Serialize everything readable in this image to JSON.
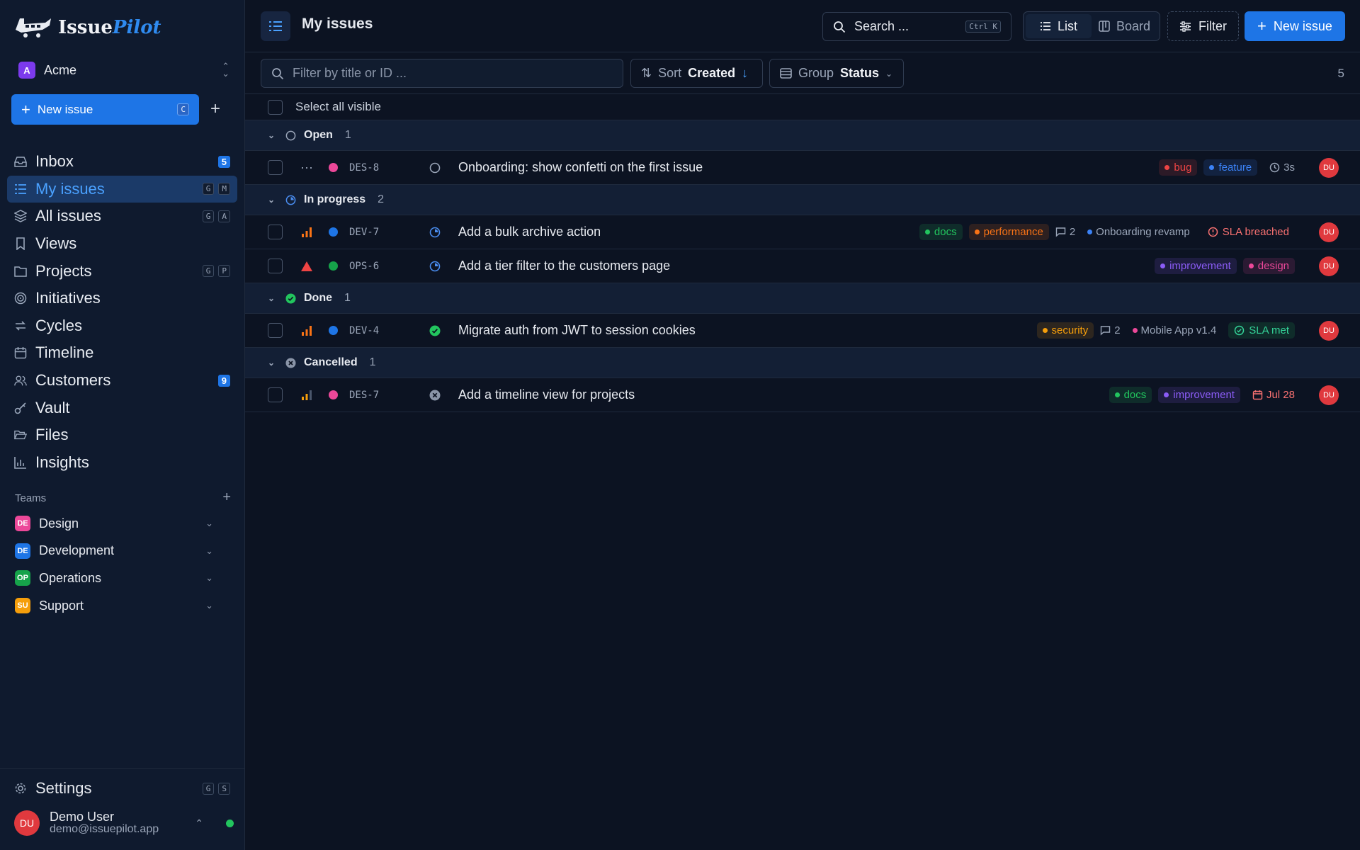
{
  "app": {
    "name_part1": "Issue",
    "name_part2": "Pilot"
  },
  "workspace": {
    "initial": "A",
    "name": "Acme"
  },
  "sidebar_new": {
    "label": "New issue",
    "shortcut": "C"
  },
  "nav": [
    {
      "label": "Inbox",
      "icon": "inbox-icon",
      "badge": "5"
    },
    {
      "label": "My issues",
      "icon": "my-issues-icon",
      "keys": [
        "G",
        "M"
      ],
      "active": true
    },
    {
      "label": "All issues",
      "icon": "layers-icon",
      "keys": [
        "G",
        "A"
      ]
    },
    {
      "label": "Views",
      "icon": "bookmark-icon"
    },
    {
      "label": "Projects",
      "icon": "folder-icon",
      "keys": [
        "G",
        "P"
      ]
    },
    {
      "label": "Initiatives",
      "icon": "target-icon"
    },
    {
      "label": "Cycles",
      "icon": "cycle-icon"
    },
    {
      "label": "Timeline",
      "icon": "calendar-icon"
    },
    {
      "label": "Customers",
      "icon": "users-icon",
      "badge": "9"
    },
    {
      "label": "Vault",
      "icon": "key-icon"
    },
    {
      "label": "Files",
      "icon": "folder-open-icon"
    },
    {
      "label": "Insights",
      "icon": "chart-icon"
    }
  ],
  "teams_heading": "Teams",
  "teams": [
    {
      "initials": "DE",
      "name": "Design",
      "color": "#ec4899"
    },
    {
      "initials": "DE",
      "name": "Development",
      "color": "#1e75e6"
    },
    {
      "initials": "OP",
      "name": "Operations",
      "color": "#16a34a"
    },
    {
      "initials": "SU",
      "name": "Support",
      "color": "#f59e0b"
    }
  ],
  "settings": {
    "label": "Settings",
    "keys": [
      "G",
      "S"
    ]
  },
  "user": {
    "initials": "DU",
    "name": "Demo User",
    "email": "demo@issuepilot.app"
  },
  "header": {
    "title": "My issues"
  },
  "search": {
    "placeholder": "Search ...",
    "shortcut": "Ctrl K"
  },
  "view_switch": {
    "list": "List",
    "board": "Board",
    "selected": "List"
  },
  "filter_label": "Filter",
  "new_issue_label": "New issue",
  "toolbar": {
    "filter_placeholder": "Filter by title or ID ...",
    "sort_label": "Sort",
    "sort_value": "Created",
    "group_label": "Group",
    "group_value": "Status",
    "count": "5"
  },
  "select_all_label": "Select all visible",
  "groups": [
    {
      "name": "Open",
      "count": "1",
      "status": "open",
      "issues": [
        {
          "id": "DES-8",
          "title": "Onboarding: show confetti on the first issue",
          "priority": "none",
          "team_color": "#ec4899",
          "labels": [
            {
              "text": "bug",
              "color": "#ef4444"
            },
            {
              "text": "feature",
              "color": "#3b82f6"
            }
          ],
          "time": "3s"
        }
      ]
    },
    {
      "name": "In progress",
      "count": "2",
      "status": "progress",
      "issues": [
        {
          "id": "DEV-7",
          "title": "Add a bulk archive action",
          "priority": "high",
          "team_color": "#1e75e6",
          "labels": [
            {
              "text": "docs",
              "color": "#22c55e"
            },
            {
              "text": "performance",
              "color": "#f97316"
            }
          ],
          "comments": "2",
          "project": "Onboarding revamp",
          "project_color": "#3b82f6",
          "sla": "SLA breached",
          "sla_state": "breached"
        },
        {
          "id": "OPS-6",
          "title": "Add a tier filter to the customers page",
          "priority": "urgent",
          "team_color": "#16a34a",
          "labels": [
            {
              "text": "improvement",
              "color": "#8b5cf6"
            },
            {
              "text": "design",
              "color": "#ec4899"
            }
          ]
        }
      ]
    },
    {
      "name": "Done",
      "count": "1",
      "status": "done",
      "issues": [
        {
          "id": "DEV-4",
          "title": "Migrate auth from JWT to session cookies",
          "priority": "high",
          "team_color": "#1e75e6",
          "labels": [
            {
              "text": "security",
              "color": "#f59e0b"
            }
          ],
          "comments": "2",
          "project": "Mobile App v1.4",
          "project_color": "#ec4899",
          "sla": "SLA met",
          "sla_state": "met"
        }
      ]
    },
    {
      "name": "Cancelled",
      "count": "1",
      "status": "cancelled",
      "issues": [
        {
          "id": "DES-7",
          "title": "Add a timeline view for projects",
          "priority": "medium",
          "team_color": "#ec4899",
          "labels": [
            {
              "text": "docs",
              "color": "#22c55e"
            },
            {
              "text": "improvement",
              "color": "#8b5cf6"
            }
          ],
          "due": "Jul 28"
        }
      ]
    }
  ],
  "assignee_initials": "DU"
}
